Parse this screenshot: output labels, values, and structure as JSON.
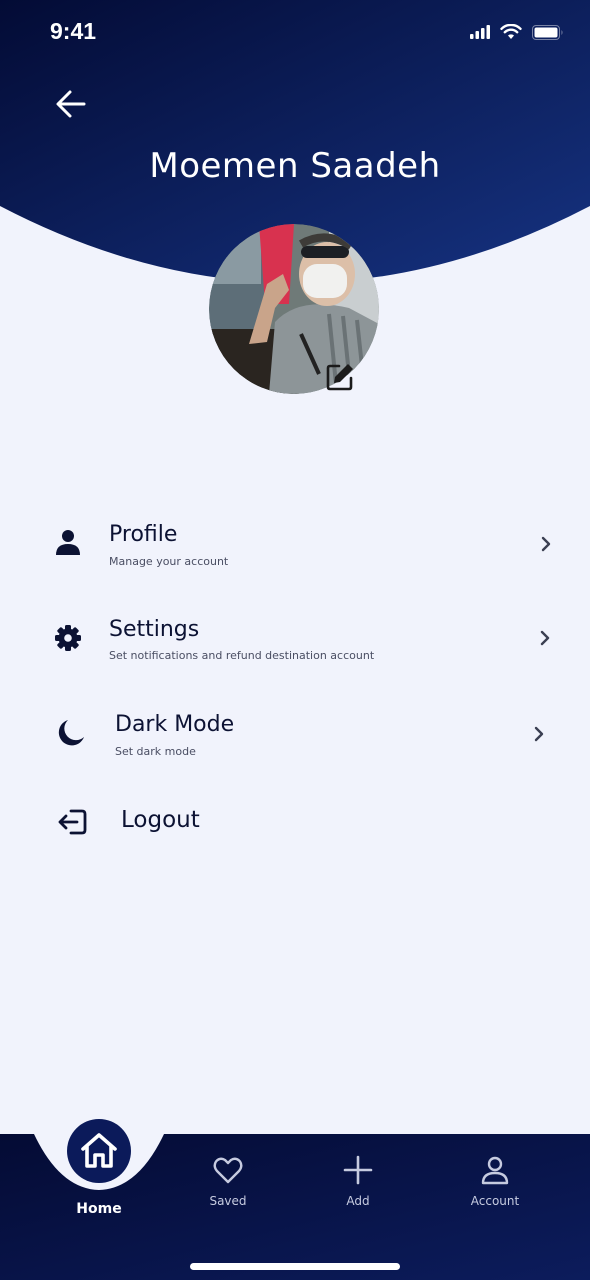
{
  "status_bar": {
    "time": "9:41"
  },
  "header": {
    "title": "Moemen Saadeh"
  },
  "menu": {
    "profile": {
      "label": "Profile",
      "subtitle": "Manage your account"
    },
    "settings": {
      "label": "Settings",
      "subtitle": "Set notifications and refund destination account"
    },
    "dark_mode": {
      "label": "Dark Mode",
      "subtitle": "Set dark mode"
    },
    "logout": {
      "label": "Logout"
    }
  },
  "bottom_nav": {
    "home": "Home",
    "saved": "Saved",
    "add": "Add",
    "account": "Account"
  },
  "colors": {
    "header_dark": "#030b35",
    "header_light": "#142d7a",
    "background": "#f1f3fc",
    "text_primary": "#0c1233",
    "nav_background": "#06103c"
  },
  "icons": {
    "back": "arrow-left-icon",
    "edit": "edit-icon",
    "profile": "person-icon",
    "settings": "gear-icon",
    "dark_mode": "moon-icon",
    "logout": "logout-icon",
    "chevron": "chevron-right-icon",
    "home": "home-icon",
    "saved": "heart-icon",
    "add": "plus-icon",
    "account": "person-outline-icon"
  }
}
